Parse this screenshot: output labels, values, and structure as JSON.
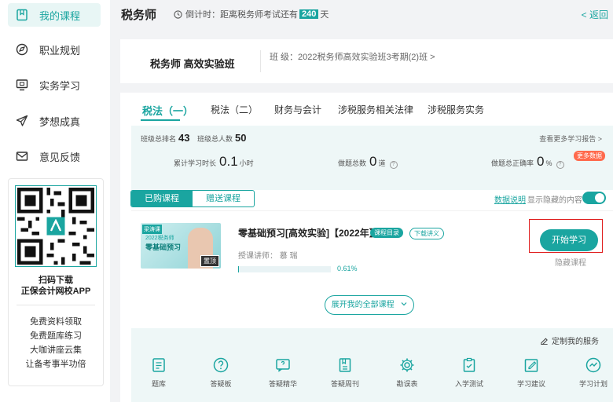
{
  "sidebar": {
    "items": [
      {
        "label": "我的课程",
        "icon": "bookmark-icon",
        "active": true
      },
      {
        "label": "职业规划",
        "icon": "compass-icon",
        "active": false
      },
      {
        "label": "实务学习",
        "icon": "monitor-icon",
        "active": false
      },
      {
        "label": "梦想成真",
        "icon": "paper-plane-icon",
        "active": false
      },
      {
        "label": "意见反馈",
        "icon": "mail-icon",
        "active": false
      }
    ],
    "qr": {
      "title_line1": "扫码下载",
      "title_line2": "正保会计网校APP",
      "links": [
        "免费资料领取",
        "免费题库练习",
        "大咖讲座云集",
        "让备考事半功倍"
      ]
    }
  },
  "header": {
    "title": "税务师",
    "countdown_prefix": "倒计时：距离税务师考试还有",
    "countdown_days": "240",
    "countdown_unit": "天",
    "back_label": "< 返回"
  },
  "class_card": {
    "name": "税务师 高效实验班",
    "info": "班   级：2022税务师高效实验班3考期(2)班 >"
  },
  "tabs": [
    "税法（一）",
    "税法（二）",
    "财务与会计",
    "涉税服务相关法律",
    "涉税服务实务"
  ],
  "stats": {
    "rank_label": "班级总排名",
    "rank_value": "43",
    "total_label": "班级总人数",
    "total_value": "50",
    "more_report": "查看更多学习报告 >",
    "study_time_label": "累计学习时长",
    "study_time_value": "0.1",
    "study_time_unit": "小时",
    "questions_label": "做题总数",
    "questions_value": "0",
    "questions_unit": "道",
    "accuracy_label": "做题总正确率",
    "accuracy_value": "0",
    "accuracy_unit": "%",
    "more_data": "更多数据"
  },
  "course_filter": {
    "purchased": "已购课程",
    "gifted": "赠送课程",
    "data_desc": "数据说明",
    "show_hidden": "显示隐藏的内容"
  },
  "course": {
    "thumb_brand": "梁涛课",
    "thumb_sub": "2022税务师",
    "thumb_title": "零基础预习",
    "thumb_pin": "置顶",
    "title": "零基础预习[高效实验]【2022年】",
    "badge_catalog": "课程目录",
    "badge_handout": "下载讲义",
    "teacher": "授课讲师：  慕   瑞",
    "progress_percent": 0.61,
    "progress_text": "0.61%",
    "start_label": "开始学习",
    "hide_label": "隐藏课程"
  },
  "expand_label": "展开我的全部课程",
  "services": {
    "custom_label": "定制我的服务",
    "items": [
      {
        "label": "题库",
        "icon": "question-bank-icon"
      },
      {
        "label": "答疑板",
        "icon": "qa-board-icon"
      },
      {
        "label": "答疑精华",
        "icon": "qa-highlight-icon"
      },
      {
        "label": "答疑周刊",
        "icon": "qa-weekly-icon"
      },
      {
        "label": "勘误表",
        "icon": "errata-gear-icon"
      },
      {
        "label": "入学测试",
        "icon": "entrance-test-icon"
      },
      {
        "label": "学习建议",
        "icon": "study-advice-icon"
      },
      {
        "label": "学习计划",
        "icon": "study-plan-icon"
      }
    ]
  },
  "colors": {
    "accent": "#1aa5a0",
    "highlight_frame": "#e02020",
    "badge_orange": "#ff6a4d"
  }
}
